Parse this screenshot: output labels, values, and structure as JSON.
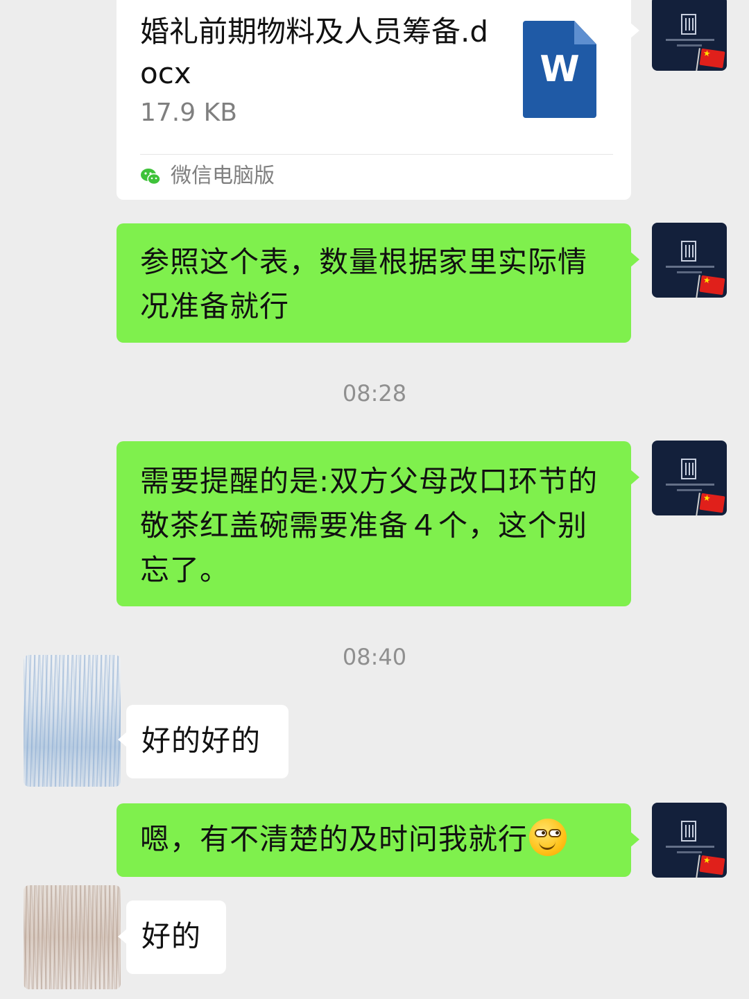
{
  "file_message": {
    "file_name": "婚礼前期物料及人员筹备.docx",
    "file_size": "17.9 KB",
    "file_icon": "word-doc-icon",
    "file_icon_letter": "W",
    "source": "微信电脑版",
    "source_icon": "wechat-icon"
  },
  "messages": [
    {
      "text": "参照这个表，数量根据家里实际情况准备就行"
    },
    {
      "text": "需要提醒的是:双方父母改口环节的敬茶红盖碗需要准备４个，这个别忘了。"
    },
    {
      "text": "好的好的"
    },
    {
      "text": "嗯，有不清楚的及时问我就行",
      "emoji": "grinning-face-emoji"
    },
    {
      "text": "好的"
    }
  ],
  "timestamps": [
    "08:28",
    "08:40"
  ],
  "colors": {
    "background": "#ededed",
    "self_bubble": "#7ff04d",
    "other_bubble": "#ffffff",
    "self_avatar_bg": "#13203b",
    "word_blue": "#1f5aa6"
  }
}
